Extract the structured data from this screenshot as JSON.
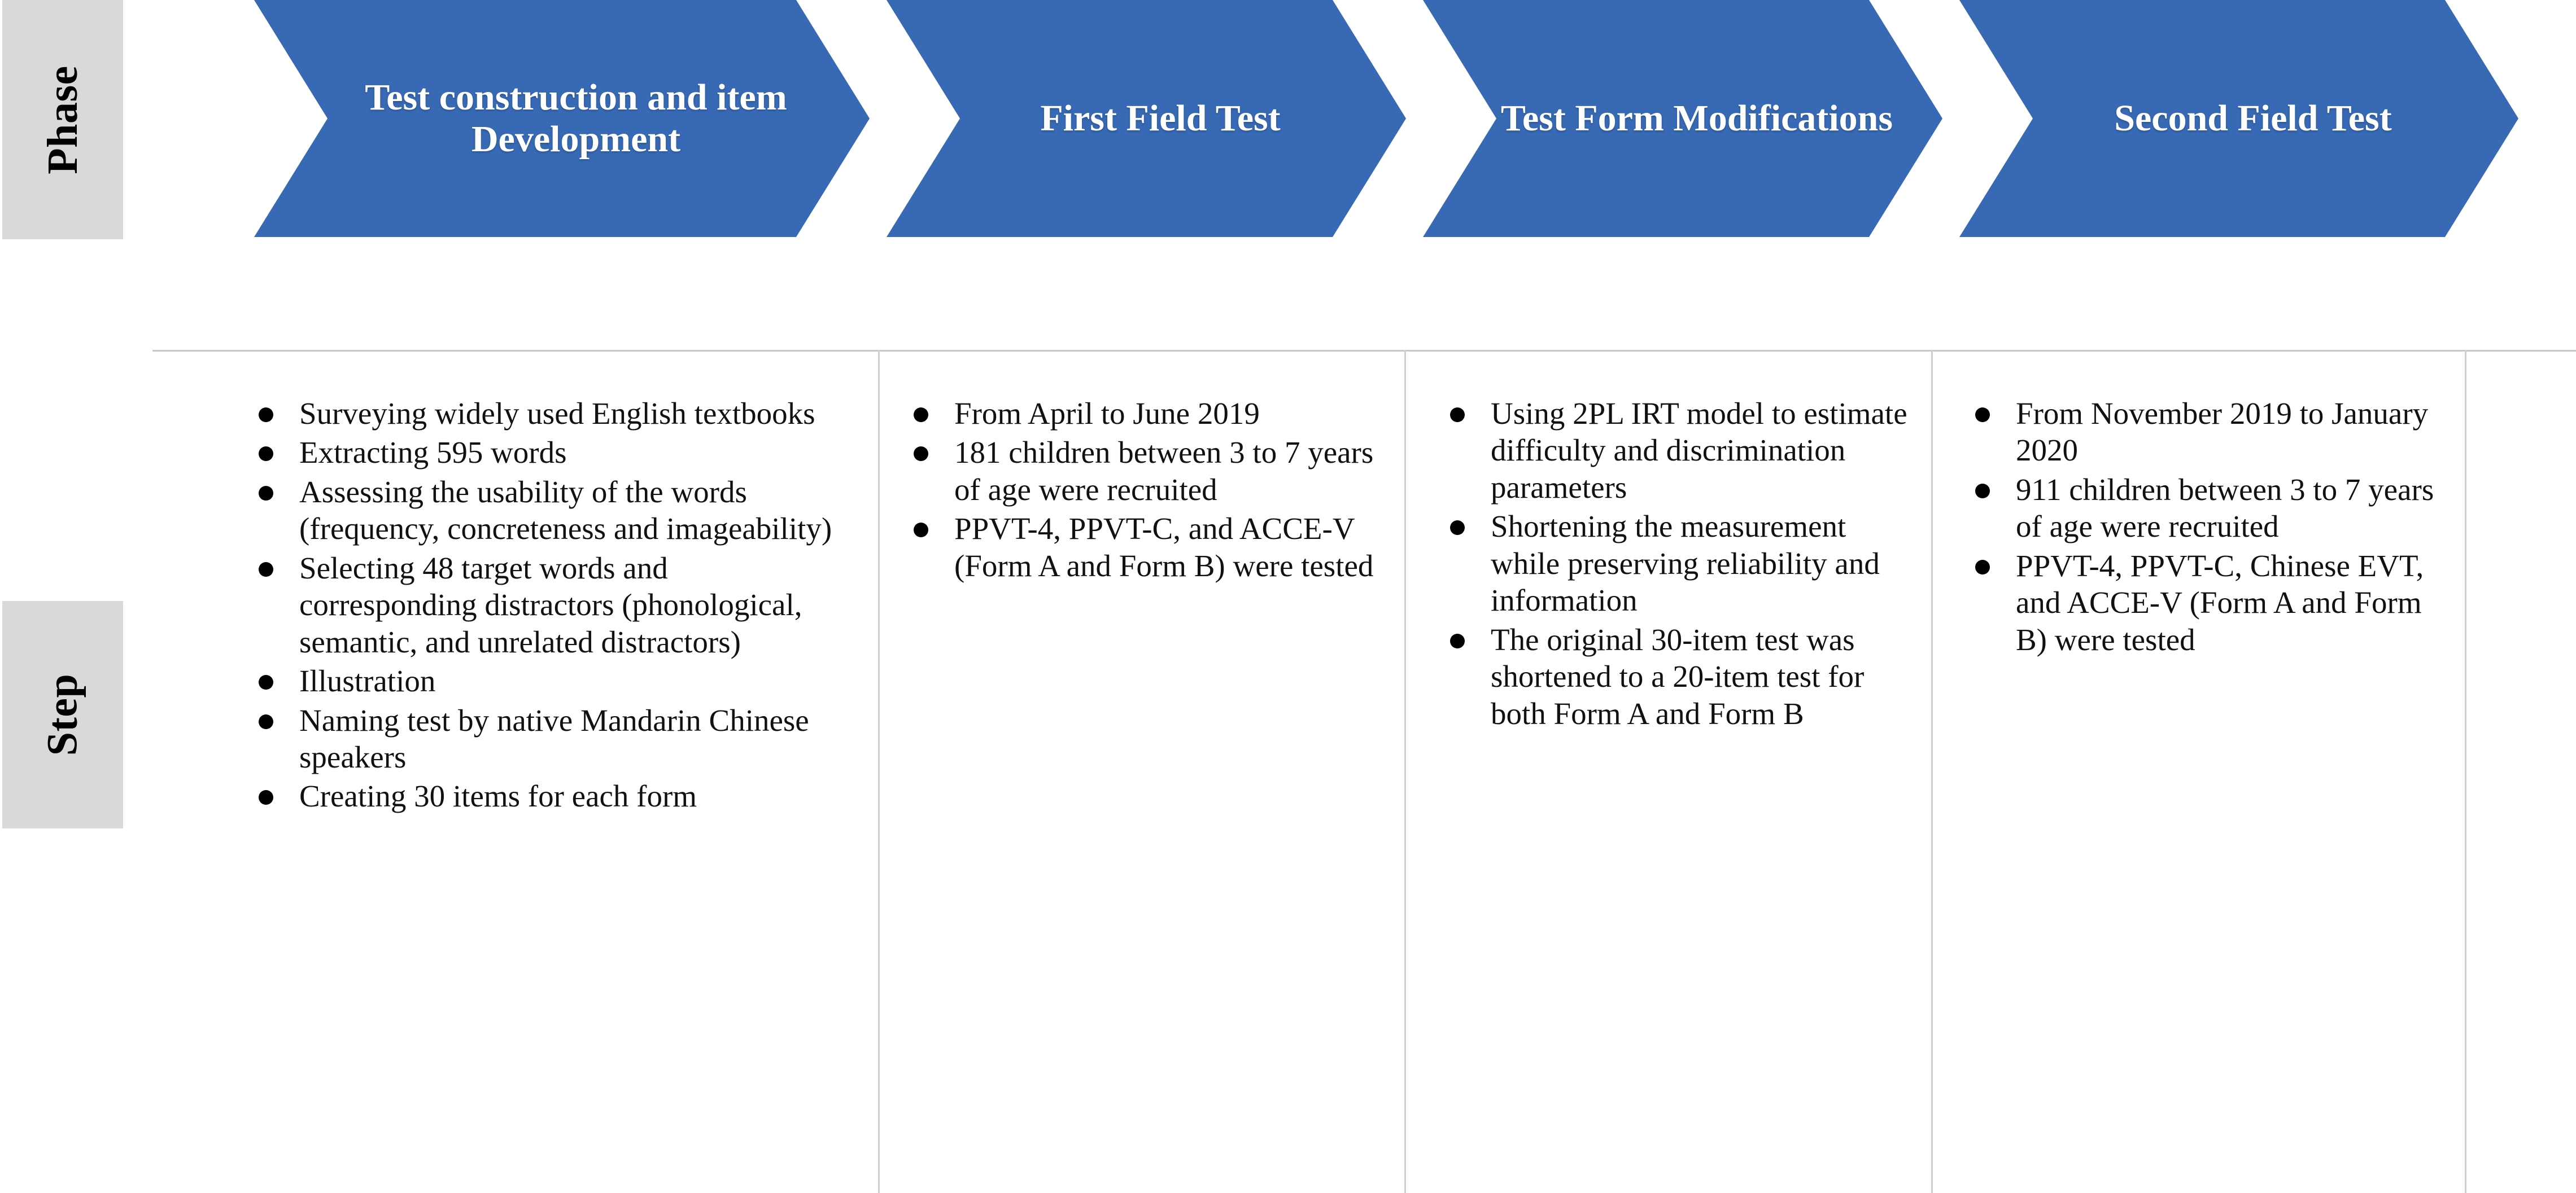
{
  "axis_labels": {
    "phase": "Phase",
    "step": "Step"
  },
  "colors": {
    "chevron_fill": "#3769b4",
    "chevron_text": "#ffffff",
    "axis_label_bg": "#d9d9d9",
    "divider": "#cfcfcf",
    "body_text": "#111111"
  },
  "phases": [
    {
      "title": "Test construction and item Development"
    },
    {
      "title": "First Field Test"
    },
    {
      "title": "Test Form Modifications"
    },
    {
      "title": "Second Field Test"
    }
  ],
  "steps": [
    {
      "items": [
        "Surveying widely used English textbooks",
        "Extracting 595 words",
        "Assessing the usability of the words (frequency, concreteness and imageability)",
        "Selecting 48 target words and corresponding distractors (phonological, semantic, and unrelated distractors)",
        "Illustration",
        "Naming test by native Mandarin Chinese speakers",
        "Creating 30 items for each form"
      ]
    },
    {
      "items": [
        "From April to June 2019",
        "181 children between 3 to 7 years of age were recruited",
        "PPVT-4, PPVT-C, and ACCE-V (Form A and Form B) were tested"
      ]
    },
    {
      "items": [
        "Using 2PL IRT model to estimate difficulty and discrimination parameters",
        "Shortening the measurement while preserving reliability and information",
        "The original 30-item test was shortened to a 20-item test for both Form A and Form B"
      ]
    },
    {
      "items": [
        "From November 2019 to January 2020",
        "911 children between 3 to 7 years of age were recruited",
        "PPVT-4, PPVT-C, Chinese EVT, and ACCE-V (Form A and Form B) were tested"
      ]
    }
  ]
}
